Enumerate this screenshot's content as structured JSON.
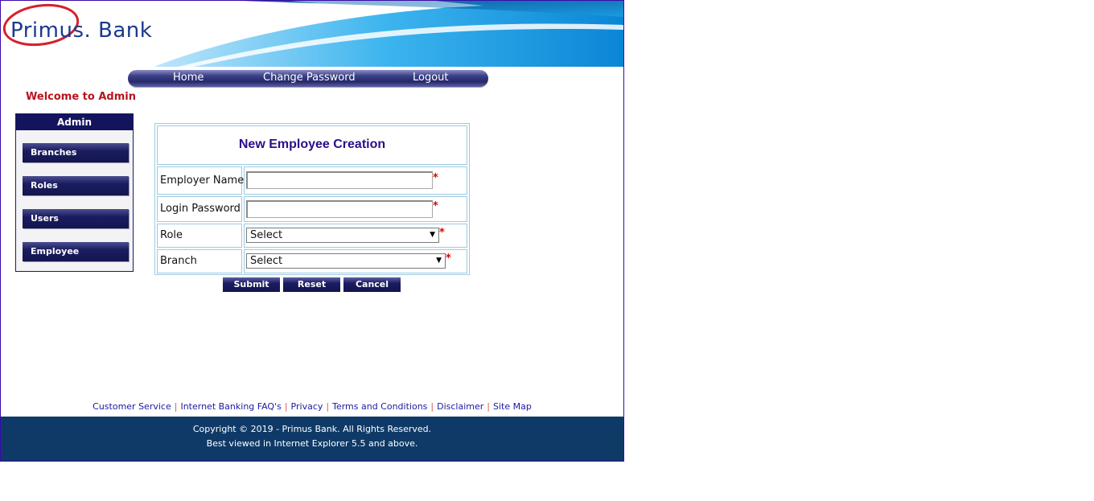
{
  "brand": {
    "logo_text": "Primus. Bank",
    "colors": {
      "logo_blue": "#1b3a8e",
      "logo_ring_red": "#d6202a",
      "banner_blue": "#1aa7e8"
    }
  },
  "nav": {
    "items": [
      {
        "label": "Home"
      },
      {
        "label": "Change Password"
      },
      {
        "label": "Logout"
      }
    ]
  },
  "welcome_text": "Welcome to Admin",
  "sidebar": {
    "title": "Admin",
    "items": [
      {
        "label": "Branches"
      },
      {
        "label": "Roles"
      },
      {
        "label": "Users"
      },
      {
        "label": "Employee"
      }
    ]
  },
  "form": {
    "title": "New Employee Creation",
    "fields": {
      "employer_name": {
        "label": "Employer Name",
        "value": "",
        "required_mark": "*"
      },
      "login_password": {
        "label": "Login Password",
        "value": "",
        "required_mark": "*"
      },
      "role": {
        "label": "Role",
        "selected": "Select",
        "required_mark": "*"
      },
      "branch": {
        "label": "Branch",
        "selected": "Select",
        "required_mark": "*"
      }
    },
    "buttons": {
      "submit": "Submit",
      "reset": "Reset",
      "cancel": "Cancel"
    }
  },
  "footer": {
    "links": [
      {
        "label": "Customer Service"
      },
      {
        "label": "Internet Banking FAQ's"
      },
      {
        "label": "Privacy"
      },
      {
        "label": "Terms and Conditions"
      },
      {
        "label": "Disclaimer"
      },
      {
        "label": "Site Map"
      }
    ],
    "separator": "|",
    "copyright": "Copyright © 2019 - Primus Bank. All Rights Reserved.",
    "browser_note": "Best viewed in Internet Explorer 5.5 and above."
  }
}
